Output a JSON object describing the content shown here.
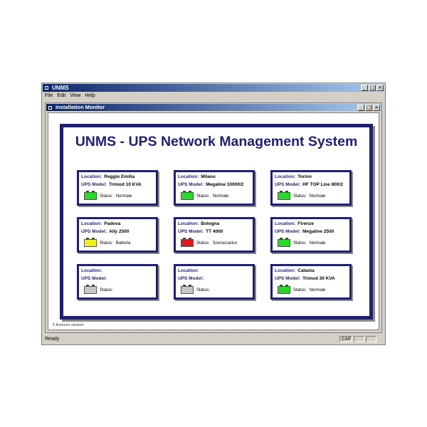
{
  "app": {
    "title": "UNMS",
    "window_buttons": [
      "_",
      "□",
      "×"
    ],
    "menu": [
      "File",
      "Edit",
      "View",
      "Help"
    ]
  },
  "child_window": {
    "title": "Installation Monitor",
    "window_buttons": [
      "_",
      "□",
      "×"
    ]
  },
  "panel": {
    "headline": "UNMS - UPS Network Management System",
    "location_label": "Location:",
    "model_label": "UPS Model:",
    "status_label": "Status:",
    "cards": [
      {
        "location": "Reggio Emilia",
        "model": "Trimod 10 KVA",
        "status": "Normale",
        "color": "#22dd22"
      },
      {
        "location": "Milano",
        "model": "Megaline 10000/2",
        "status": "Normale",
        "color": "#22dd22"
      },
      {
        "location": "Torino",
        "model": "HF TOP Line 800/2",
        "status": "Normale",
        "color": "#22dd22"
      },
      {
        "location": "Padova",
        "model": "Ally 2500",
        "status": "Batteria",
        "color": "#f2f21a"
      },
      {
        "location": "Bologna",
        "model": "TT 4000",
        "status": "Sovraccarico",
        "color": "#e01a1a"
      },
      {
        "location": "Firenze",
        "model": "Megaline 2500",
        "status": "Normale",
        "color": "#22dd22"
      },
      {
        "location": "",
        "model": "",
        "status": "",
        "color": "#c8c8c8"
      },
      {
        "location": "",
        "model": "",
        "status": "",
        "color": "#c8c8c8"
      },
      {
        "location": "Catania",
        "model": "Trimod 30 KVA",
        "status": "Normale",
        "color": "#22dd22"
      }
    ]
  },
  "footnote": "5 licences version",
  "statusbar": {
    "text": "Ready",
    "indicator": "CAP"
  }
}
